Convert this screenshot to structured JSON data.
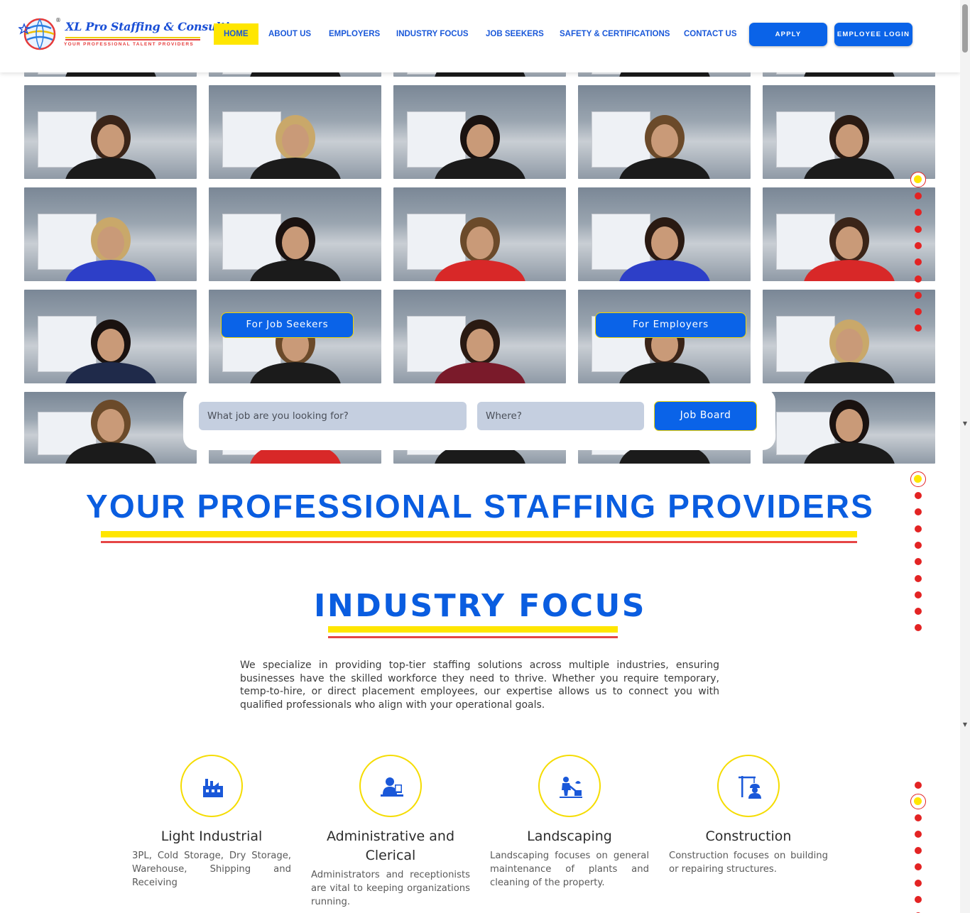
{
  "brand": {
    "name": "XL Pro Staffing & Consulting",
    "registered": "®",
    "tagline": "YOUR PROFESSIONAL TALENT PROVIDERS"
  },
  "nav": {
    "items": [
      "HOME",
      "ABOUT US",
      "EMPLOYERS",
      "INDUSTRY FOCUS",
      "JOB SEEKERS",
      "SAFETY & CERTIFICATIONS",
      "CONTACT US"
    ],
    "active_index": 0,
    "apply_label": "APPLY",
    "login_label": "EMPLOYEE LOGIN"
  },
  "hero": {
    "job_seekers_label": "For Job Seekers",
    "employers_label": "For Employers",
    "search": {
      "job_placeholder": "What job are you looking for?",
      "where_placeholder": "Where?",
      "button_label": "Job Board"
    }
  },
  "headline": "YOUR PROFESSIONAL STAFFING PROVIDERS",
  "industry": {
    "title": "INDUSTRY FOCUS",
    "intro": "We specialize in providing top-tier staffing solutions across multiple industries, ensuring businesses have the skilled workforce they need to thrive. Whether you require temporary, temp-to-hire, or direct placement employees, our expertise allows us to connect you with qualified professionals who align with your operational goals.",
    "cards": [
      {
        "title": "Light Industrial",
        "desc": "3PL, Cold Storage, Dry Storage, Warehouse, Shipping and Receiving",
        "icon": "factory-icon"
      },
      {
        "title": "Administrative and Clerical",
        "desc": "Administrators and receptionists are vital to keeping organizations running.",
        "icon": "office-worker-icon"
      },
      {
        "title": "Landscaping",
        "desc": "Landscaping focuses on general maintenance of plants and cleaning of the property.",
        "icon": "landscaper-icon"
      },
      {
        "title": "Construction",
        "desc": "Construction focuses on building or repairing structures.",
        "icon": "construction-worker-icon"
      }
    ]
  },
  "colors": {
    "primary_blue": "#0a63e8",
    "accent_yellow": "#ffe600",
    "accent_red": "#e32323"
  }
}
